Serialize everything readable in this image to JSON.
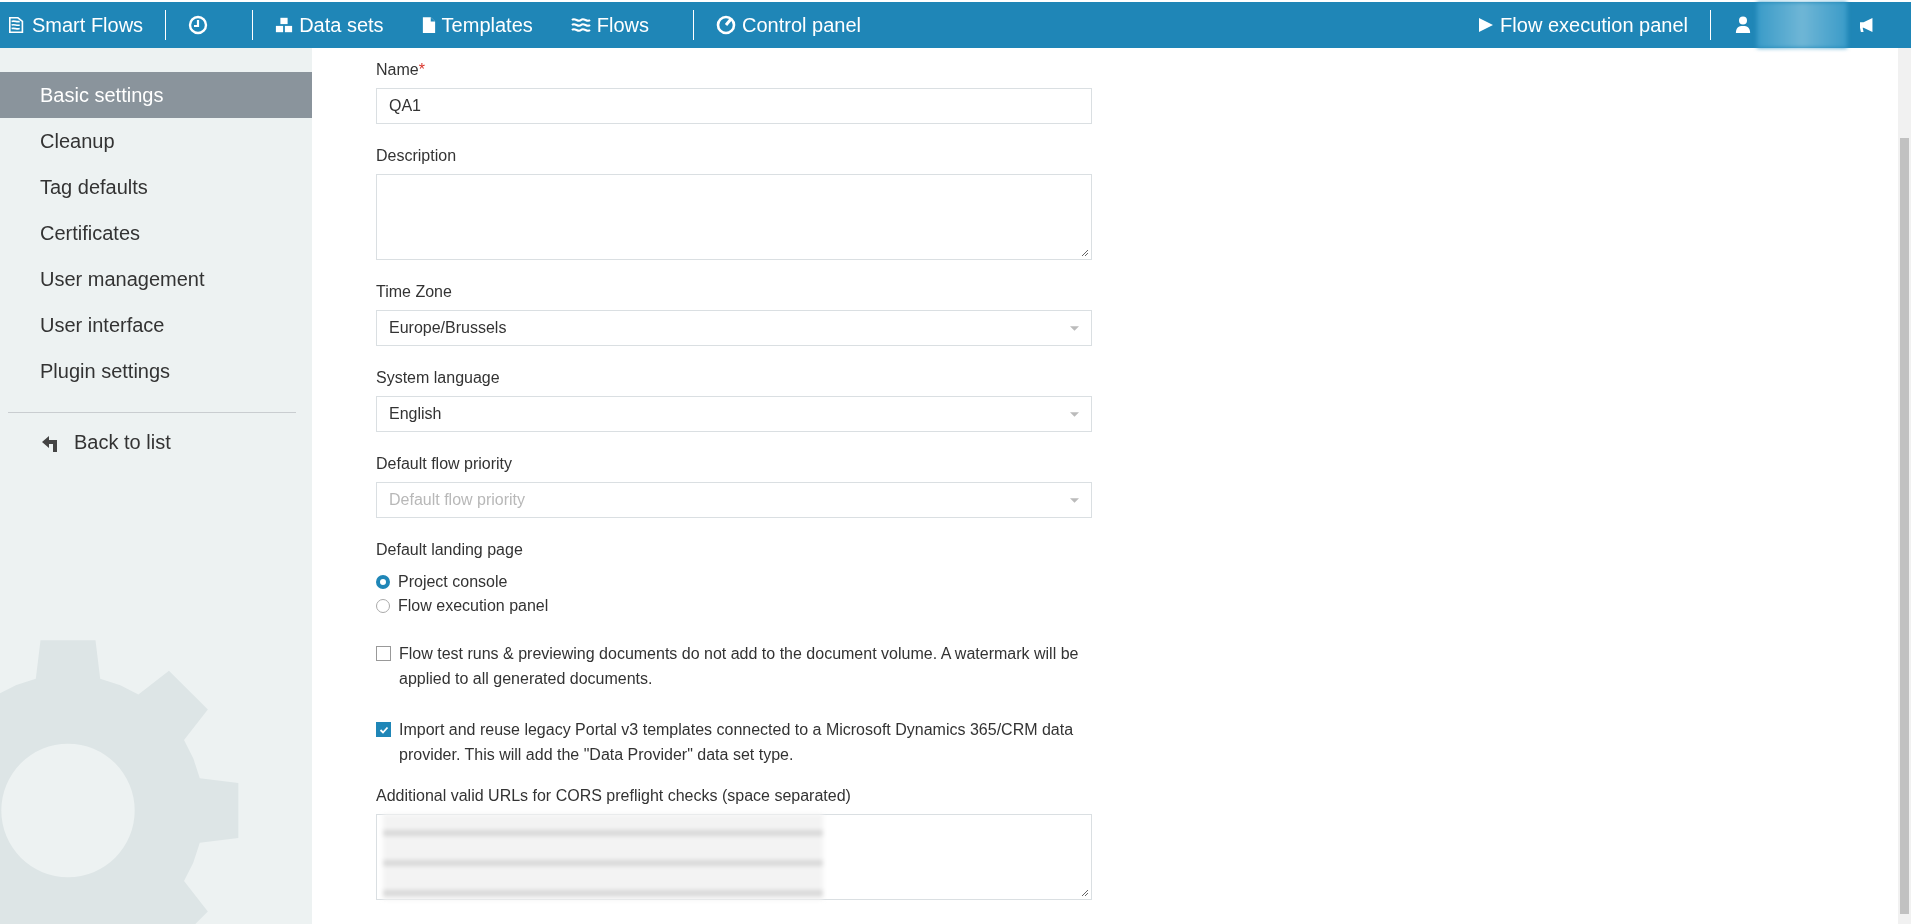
{
  "app": {
    "title": "Smart Flows"
  },
  "nav_groups": [
    [
      {
        "kind": "clock"
      }
    ],
    [
      {
        "kind": "datasets",
        "label": "Data sets"
      },
      {
        "kind": "document",
        "label": "Templates"
      },
      {
        "kind": "waves",
        "label": "Flows"
      }
    ],
    [
      {
        "kind": "gauge",
        "label": "Control panel"
      }
    ]
  ],
  "nav_right": [
    {
      "kind": "play",
      "label": "Flow execution panel"
    }
  ],
  "sidebar": {
    "items": [
      {
        "label": "Basic settings",
        "selected": true
      },
      {
        "label": "Cleanup",
        "selected": false
      },
      {
        "label": "Tag defaults",
        "selected": false
      },
      {
        "label": "Certificates",
        "selected": false
      },
      {
        "label": "User management",
        "selected": false
      },
      {
        "label": "User interface",
        "selected": false
      },
      {
        "label": "Plugin settings",
        "selected": false
      }
    ],
    "back_link": {
      "label": "Back to list"
    }
  },
  "fields": [
    {
      "kind": "text",
      "label": "Name",
      "required_mark": "*",
      "value": "QA1"
    },
    {
      "kind": "textarea",
      "label": "Description"
    },
    {
      "kind": "select",
      "label": "Time Zone",
      "value": "Europe/Brussels"
    },
    {
      "kind": "select",
      "label": "System language",
      "value": "English"
    },
    {
      "kind": "select",
      "label": "Default flow priority",
      "placeholder": "Default flow priority"
    },
    {
      "kind": "radio",
      "label": "Default landing page",
      "options": [
        {
          "label": "Project console",
          "selected": true
        },
        {
          "label": "Flow execution panel",
          "selected": false
        }
      ]
    },
    {
      "kind": "checkbox",
      "label": "Flow test runs & previewing documents do not add to the document volume. A watermark will be applied to all generated documents.",
      "checked": false
    },
    {
      "kind": "checkbox",
      "label": "Import and reuse legacy Portal v3 templates connected to a Microsoft Dynamics 365/CRM data provider. This will add the \"Data Provider\" data set type.",
      "checked": true
    },
    {
      "kind": "textarea",
      "label": "Additional valid URLs for CORS preflight checks (space separated)",
      "redacted": true
    }
  ]
}
